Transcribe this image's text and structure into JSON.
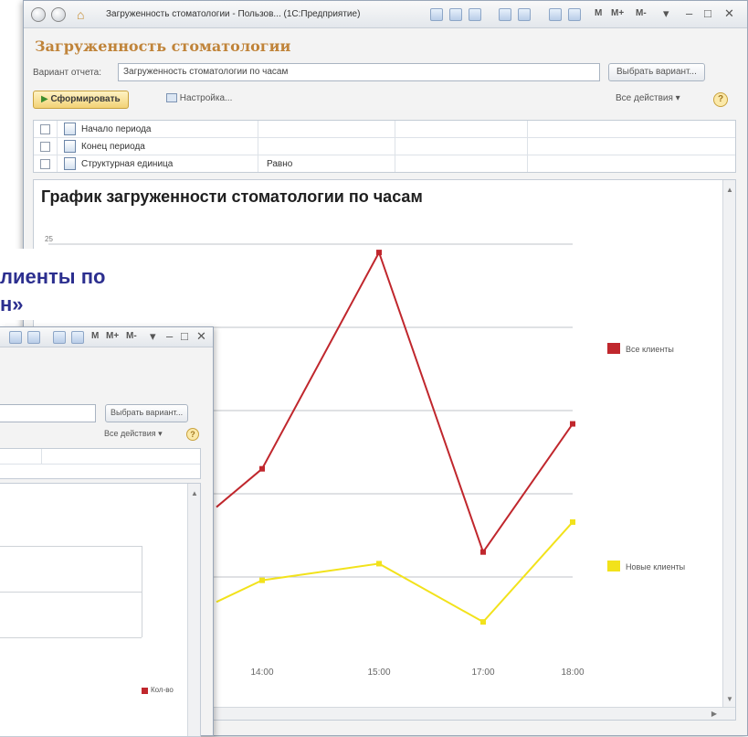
{
  "main_window": {
    "title": "Загруженность стоматологии - Пользов... (1С:Предприятие)",
    "title_controls": [
      "M",
      "M+",
      "M-"
    ],
    "form_title": "Загруженность стоматологии",
    "variant_label": "Вариант отчета:",
    "variant_value": "Загруженность стоматологии по часам",
    "choose_variant_button": "Выбрать вариант...",
    "generate_button": "Сформировать",
    "settings_button": "Настройка...",
    "all_actions": "Все действия ▾",
    "help_icon": "?",
    "filters": [
      {
        "label": "Начало периода",
        "condition": ""
      },
      {
        "label": "Конец периода",
        "condition": ""
      },
      {
        "label": "Структурная единица",
        "condition": "Равно"
      }
    ],
    "report_title": "График загруженности стоматологии по часам"
  },
  "chart_data": {
    "type": "line",
    "title": "График загруженности стоматологии по часам",
    "categories": [
      "14:00",
      "15:00",
      "17:00",
      "18:00"
    ],
    "visible_y_tick": "25",
    "series": [
      {
        "name": "Все клиенты",
        "color": "#c0272d",
        "values": [
          11.5,
          24.5,
          6.5,
          14.2
        ]
      },
      {
        "name": "Новые клиенты",
        "color": "#f2e21b",
        "values": [
          4.8,
          5.8,
          2.3,
          8.3
        ]
      }
    ],
    "legend_position": "right"
  },
  "overlay": {
    "heading_line1": "лиенты по",
    "heading_line2": "н»"
  },
  "second_window": {
    "title_controls": [
      "M",
      "M+",
      "M-"
    ],
    "choose_variant_button": "Выбрать вариант...",
    "all_actions": "Все действия ▾",
    "help_icon": "?",
    "legend_label": "Кол-во"
  }
}
